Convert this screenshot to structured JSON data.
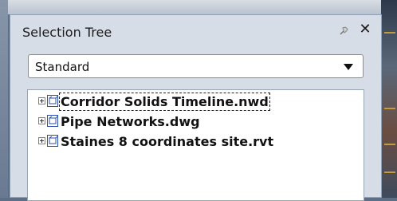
{
  "panel": {
    "title": "Selection Tree",
    "icons": [
      "pin-icon",
      "close-icon"
    ],
    "close_glyph": "✕"
  },
  "dropdown": {
    "value": "Standard",
    "icon": "chevron-down-icon"
  },
  "tree": {
    "items": [
      {
        "label": "Corridor Solids Timeline.nwd",
        "focused": true
      },
      {
        "label": "Pipe Networks.dwg",
        "focused": false
      },
      {
        "label": "Staines 8 coordinates site.rvt",
        "focused": false
      }
    ]
  }
}
